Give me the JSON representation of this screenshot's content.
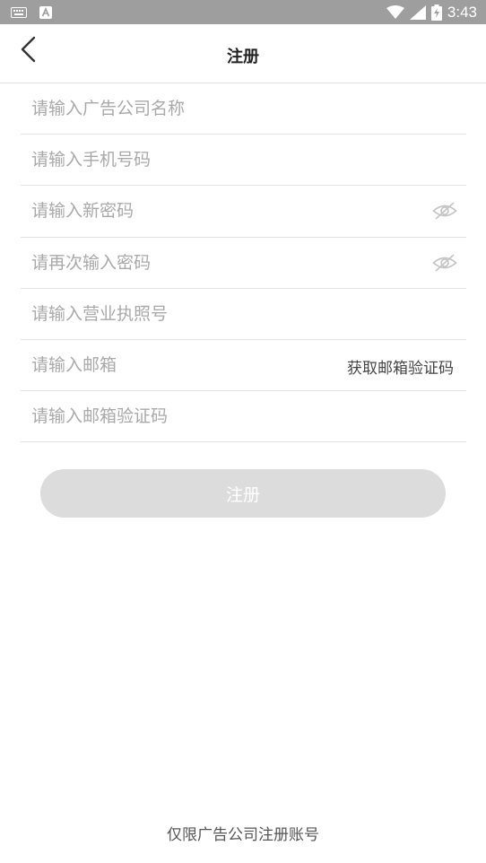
{
  "status_bar": {
    "time": "3:43",
    "icons": [
      "keyboard-icon",
      "a-badge-icon",
      "wifi-icon",
      "signal-icon",
      "battery-charging-icon"
    ]
  },
  "header": {
    "title": "注册",
    "back_icon": "chevron-left-icon"
  },
  "form": {
    "company_name_placeholder": "请输入广告公司名称",
    "phone_placeholder": "请输入手机号码",
    "new_password_placeholder": "请输入新密码",
    "confirm_password_placeholder": "请再次输入密码",
    "license_placeholder": "请输入营业执照号",
    "email_placeholder": "请输入邮箱",
    "get_email_code_label": "获取邮箱验证码",
    "email_code_placeholder": "请输入邮箱验证码"
  },
  "register_label": "注册",
  "footer_note": "仅限广告公司注册账号",
  "colors": {
    "status_bar": "#9e9e9e",
    "button_disabled": "#dcdcdc",
    "placeholder": "#a9a9a9",
    "divider": "#e3e3e3"
  }
}
